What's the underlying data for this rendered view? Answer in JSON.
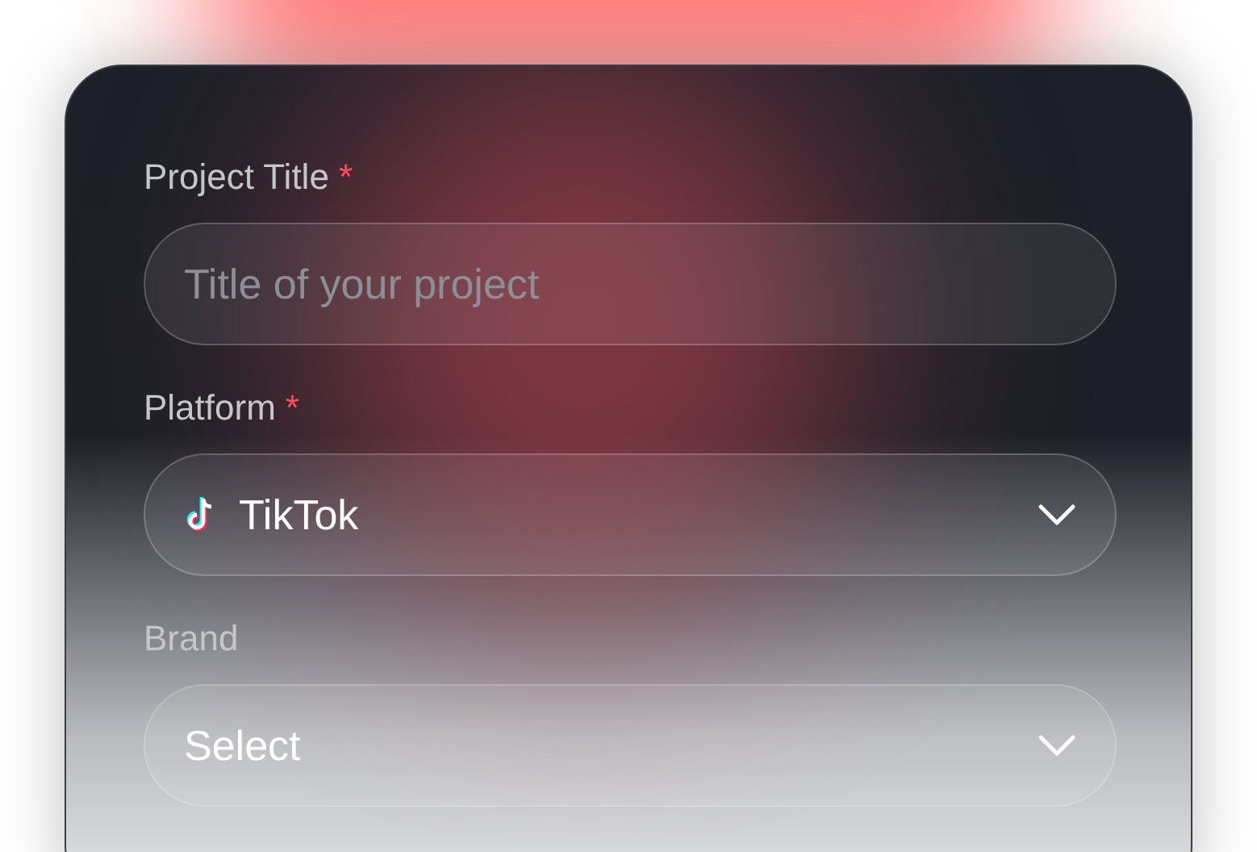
{
  "fields": [
    {
      "kind": "text",
      "label": "Project Title",
      "required_mark": "*",
      "placeholder": "Title of your project"
    },
    {
      "kind": "select",
      "label": "Platform",
      "required_mark": "*",
      "value": "TikTok",
      "logo": true
    },
    {
      "kind": "select",
      "label": "Brand",
      "value": "Select"
    }
  ]
}
